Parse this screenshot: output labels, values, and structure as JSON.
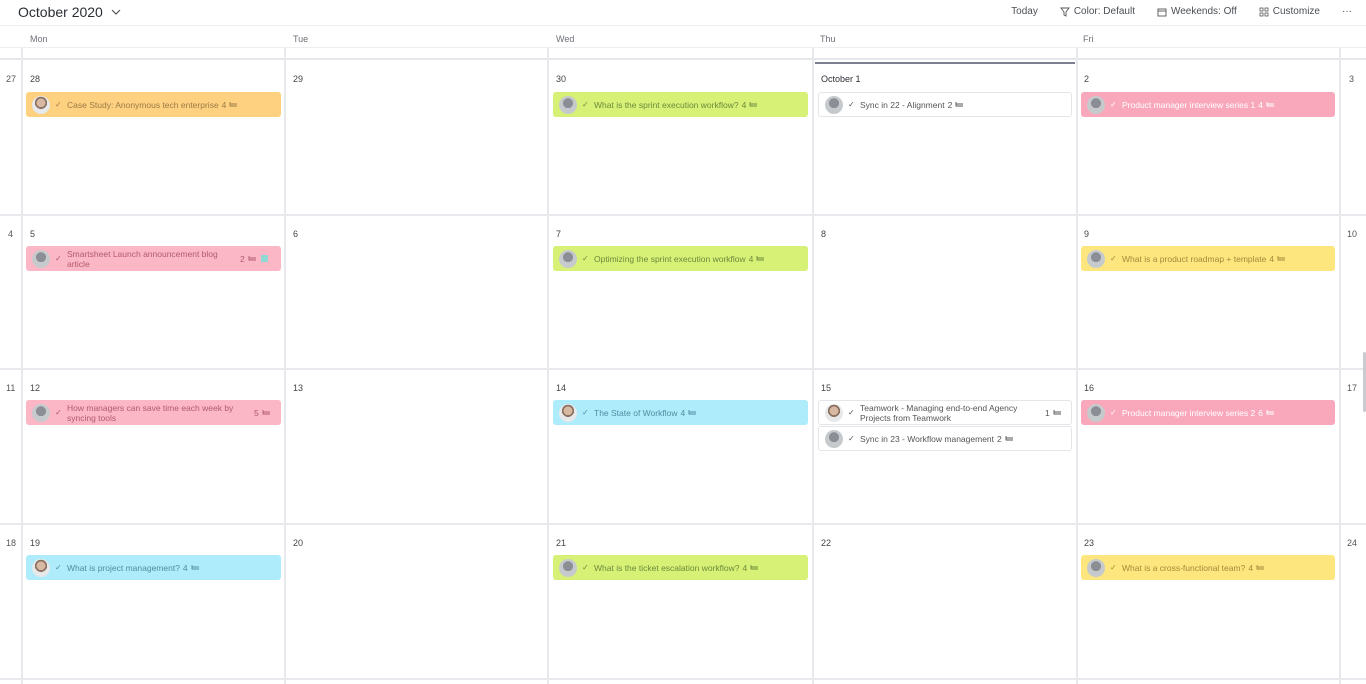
{
  "header": {
    "month": "October 2020",
    "today": "Today",
    "color": "Color: Default",
    "weekends": "Weekends: Off",
    "customize": "Customize",
    "more": "···"
  },
  "days": [
    "Mon",
    "Tue",
    "Wed",
    "Thu",
    "Fri"
  ],
  "weeks": [
    {
      "left": "27",
      "right": "3",
      "dates": [
        "28",
        "29",
        "30",
        "October 1",
        "2"
      ]
    },
    {
      "left": "4",
      "right": "10",
      "dates": [
        "5",
        "6",
        "7",
        "8",
        "9"
      ]
    },
    {
      "left": "11",
      "right": "17",
      "dates": [
        "12",
        "13",
        "14",
        "15",
        "16"
      ]
    },
    {
      "left": "18",
      "right": "24",
      "dates": [
        "19",
        "20",
        "21",
        "22",
        "23"
      ]
    }
  ],
  "events": {
    "w0mon": {
      "title": "Case Study: Anonymous tech enterprise",
      "count": "4"
    },
    "w0wed": {
      "title": "What is the sprint execution workflow?",
      "count": "4"
    },
    "w0thu": {
      "title": "Sync in 22 - Alignment",
      "count": "2"
    },
    "w0fri": {
      "title": "Product manager interview series 1",
      "count": "4"
    },
    "w1mon": {
      "title": "Smartsheet Launch announcement blog article",
      "count": "2"
    },
    "w1wed": {
      "title": "Optimizing the sprint execution workflow",
      "count": "4"
    },
    "w1fri": {
      "title": "What is a product roadmap + template",
      "count": "4"
    },
    "w2mon": {
      "title": "How managers can save time each week by syncing tools",
      "count": "5"
    },
    "w2wed": {
      "title": "The State of Workflow",
      "count": "4"
    },
    "w2thu1": {
      "title": "Teamwork - Managing end-to-end Agency Projects from Teamwork",
      "count": "1"
    },
    "w2thu2": {
      "title": "Sync in 23 - Workflow management",
      "count": "2"
    },
    "w2fri": {
      "title": "Product manager interview series 2",
      "count": "6"
    },
    "w3mon": {
      "title": "What is project management?",
      "count": "4"
    },
    "w3wed": {
      "title": "What is the ticket escalation workflow?",
      "count": "4"
    },
    "w3fri": {
      "title": "What is a cross-functional team?",
      "count": "4"
    }
  },
  "colors": {
    "orange": "#fdd180",
    "green": "#d6f176",
    "pink": "#fbb7c6",
    "yellow": "#fde67e",
    "cyan": "#aeebfb"
  },
  "icons": [
    "chevron-down-icon",
    "filter-icon",
    "calendar-icon",
    "grid-icon",
    "check-icon",
    "subtask-icon",
    "avatar-icon"
  ]
}
